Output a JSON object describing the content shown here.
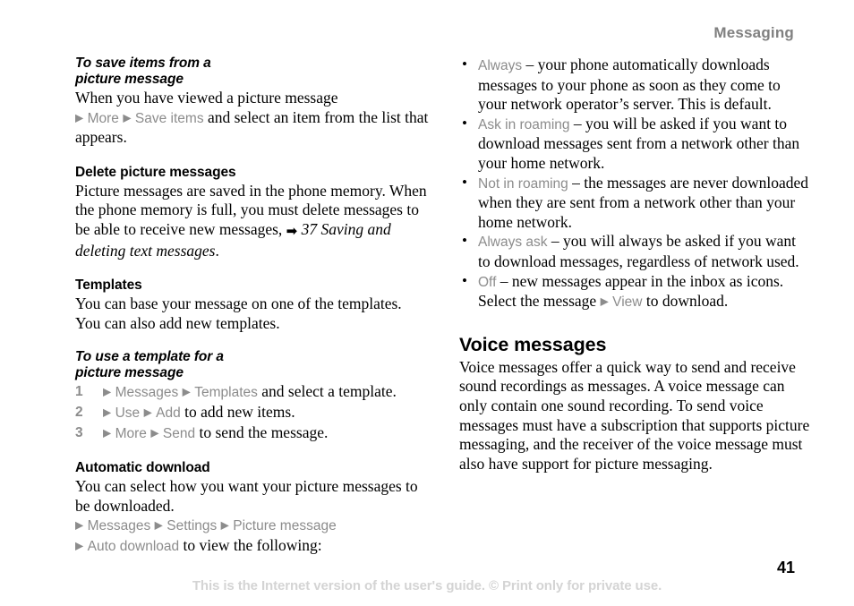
{
  "header": {
    "running_title": "Messaging"
  },
  "colors": {
    "ui_term_gray": "#8c8c8c",
    "header_gray": "#808080",
    "footer_gray": "#d4d4d4",
    "text_black": "#000000"
  },
  "icons": {
    "menu_arrow": "▶",
    "xref_arrow": "➡",
    "bullet": "•"
  },
  "left_column": {
    "save_items": {
      "heading_line1": "To save items from a",
      "heading_line2": "picture message",
      "intro": "When you have viewed a picture message",
      "path_item_1": "More",
      "path_item_2": "Save items",
      "after_path": " and select an item from the list that appears."
    },
    "delete_picture_messages": {
      "heading": "Delete picture messages",
      "body": "Picture messages are saved in the phone memory. When the phone memory is full, you must delete messages to be able to receive new messages, ",
      "xref": "37 Saving and deleting text messages",
      "xref_end": "."
    },
    "templates": {
      "heading": "Templates",
      "body": "You can base your message on one of the templates. You can also add new templates."
    },
    "use_template": {
      "heading_line1": "To use a template for a",
      "heading_line2": "picture message",
      "steps": [
        {
          "number": "1",
          "path": [
            "Messages",
            "Templates"
          ],
          "text": " and select a template."
        },
        {
          "number": "2",
          "path": [
            "Use",
            "Add"
          ],
          "text": " to add new items."
        },
        {
          "number": "3",
          "path": [
            "More",
            "Send"
          ],
          "text": " to send the message."
        }
      ]
    },
    "automatic_download": {
      "heading": "Automatic download",
      "body": "You can select how you want your picture messages to be downloaded.",
      "path_line1": [
        "Messages",
        "Settings",
        "Picture message"
      ],
      "path_line2_item": "Auto download",
      "path_line2_text": " to view the following:"
    }
  },
  "right_column": {
    "download_options": [
      {
        "term": "Always",
        "description": " – your phone automatically downloads messages to your phone as soon as they come to your network operator’s server. This is default."
      },
      {
        "term": "Ask in roaming",
        "description": " – you will be asked if you want to download messages sent from a network other than your home network."
      },
      {
        "term": "Not in roaming",
        "description": " – the messages are never downloaded when they are sent from a network other than your home network."
      },
      {
        "term": "Always ask",
        "description": " – you will always be asked if you want to download messages, regardless of network used."
      },
      {
        "term": "Off",
        "description_before": " – new messages appear in the inbox as icons. Select the message ",
        "inline_path": "View",
        "description_after": " to download."
      }
    ],
    "voice_messages": {
      "heading": "Voice messages",
      "body": "Voice messages offer a quick way to send and receive sound recordings as messages. A voice message can only contain one sound recording. To send voice messages must have a subscription that supports picture messaging, and the receiver of the voice message must also have support for picture messaging."
    }
  },
  "footer": {
    "page_number": "41",
    "note": "This is the Internet version of the user's guide. © Print only for private use."
  }
}
